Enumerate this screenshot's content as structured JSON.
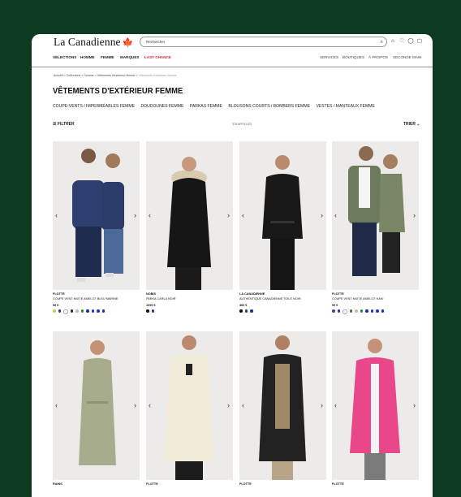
{
  "header": {
    "logo": "La Canadienne",
    "search_placeholder": "Rechercher",
    "icons": [
      "store-icon",
      "heart-icon",
      "user-icon",
      "bag-icon"
    ]
  },
  "nav": {
    "left": [
      "SÉLECTIONS",
      "HOMME",
      "FEMME",
      "MARQUES",
      "LAST CHANCE"
    ],
    "right": [
      "SERVICES",
      "BOUTIQUES",
      "À PROPOS",
      "SECONDE MAIN"
    ],
    "accent": "#e0232e"
  },
  "breadcrumb": [
    "Accueil",
    "Collections",
    "Femme",
    "Vêtements d'extérieur femme",
    "Vêtements d'extérieur femme"
  ],
  "page_title": "VÊTEMENTS D'EXTÉRIEUR FEMME",
  "categories": [
    "COUPE-VENTS / IMPERMÉABLES FEMME",
    "DOUDOUNES FEMME",
    "PARKAS FEMME",
    "BLOUSONS COURTS / BOMBERS FEMME",
    "VESTES / MANTEAUX FEMME"
  ],
  "toolbar": {
    "filter": "FILTRER",
    "count": "378 ARTICLES",
    "sort": "TRIER"
  },
  "products": [
    {
      "brand": "FLOTTE",
      "name": "COUPE VENT MIXTE AMELOT BLEU MARINE",
      "price": "99 €",
      "swatches": [
        "#d8c94a",
        "#2b3a8f",
        "#ffffff",
        "#2a2a2a",
        "#bdbdbd",
        "#2a8a3a",
        "#1b2aa8",
        "#1b3ad0",
        "#2233cc",
        "#1c2c99"
      ]
    },
    {
      "brand": "NOBIS",
      "name": "PARKA CARLA NOIR",
      "price": "1099 €",
      "swatches": [
        "#111111",
        "#2c3d7a"
      ]
    },
    {
      "brand": "LA CANADIENNE",
      "name": "AUTHENTIQUE CANADIENNE TOILE NOIR",
      "price": "460 €",
      "swatches": [
        "#111111",
        "#2c3d7a",
        "#1b2aa8"
      ]
    },
    {
      "brand": "FLOTTE",
      "name": "COUPE VENT MIXTE AMELOT KAKI",
      "price": "99 €",
      "swatches": [
        "#3f4a8a",
        "#2b3a8f",
        "#ffffff",
        "#5a6e4c",
        "#bdbdbd",
        "#2a8a3a",
        "#1b2aa8",
        "#1b3ad0",
        "#2233cc",
        "#1c2c99"
      ]
    },
    {
      "brand": "RAINS",
      "name": "",
      "price": "",
      "swatches": []
    },
    {
      "brand": "FLOTTE",
      "name": "",
      "price": "",
      "swatches": []
    },
    {
      "brand": "FLOTTE",
      "name": "",
      "price": "",
      "swatches": []
    },
    {
      "brand": "FLOTTE",
      "name": "",
      "price": "",
      "swatches": []
    }
  ]
}
